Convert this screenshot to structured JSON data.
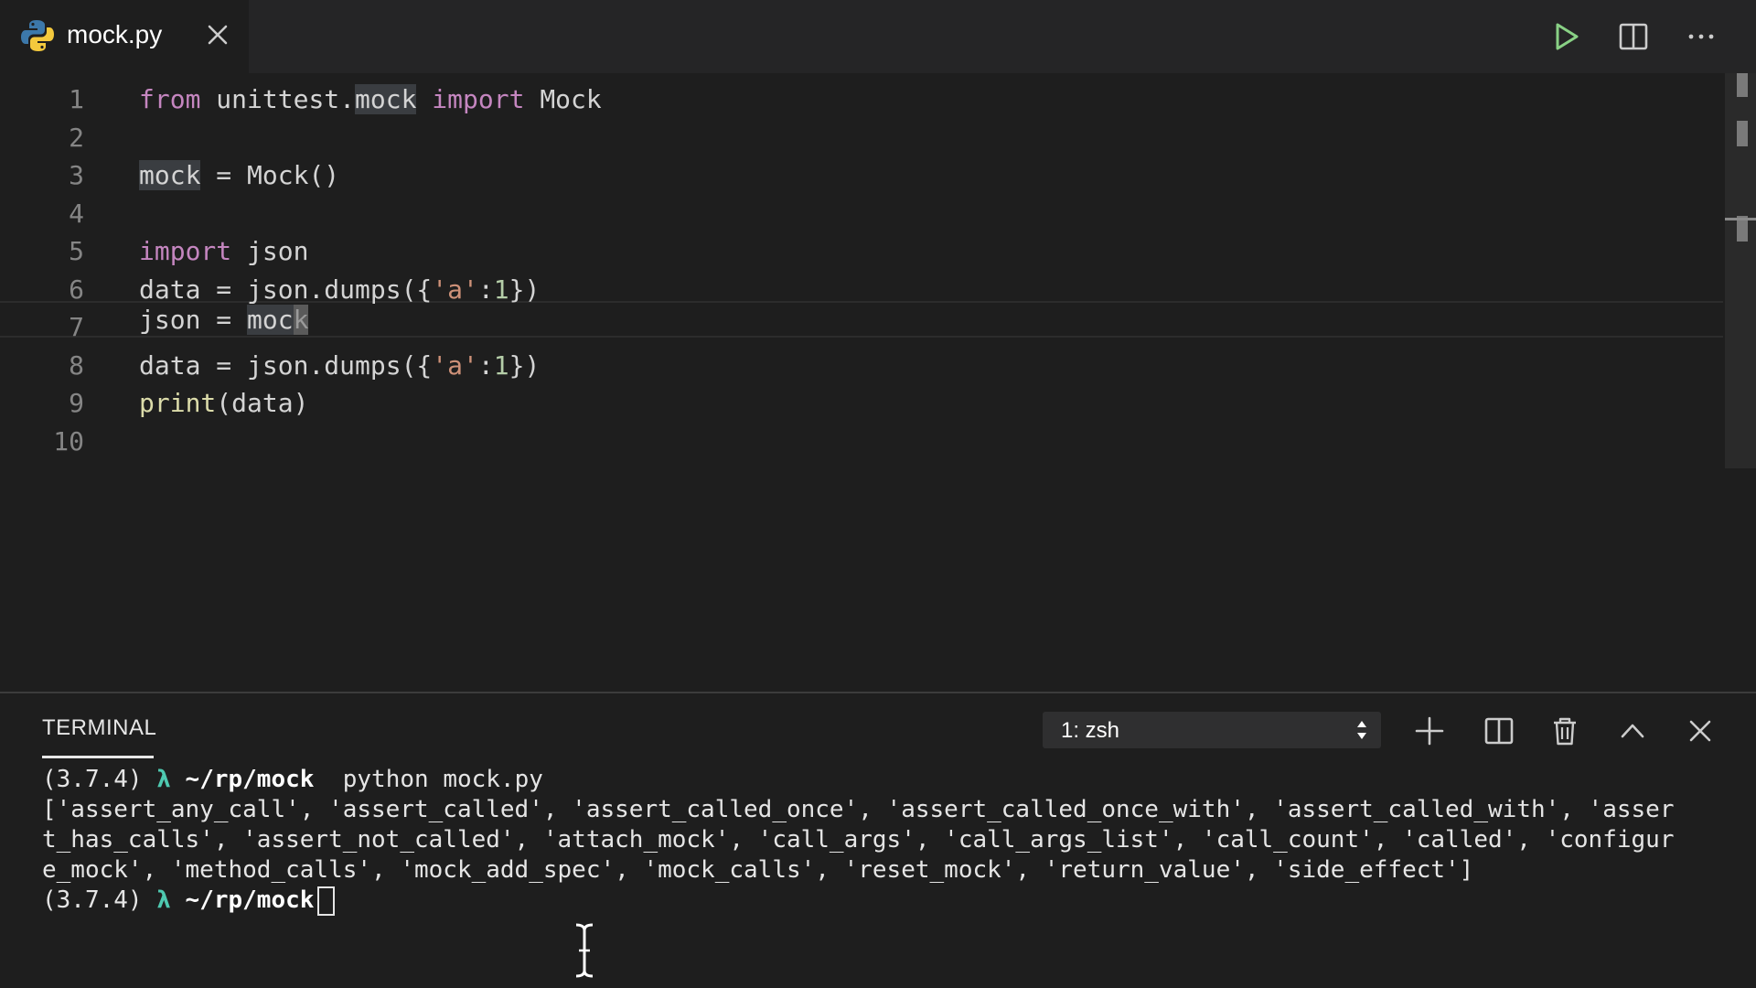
{
  "tab": {
    "filename": "mock.py"
  },
  "editor": {
    "line_numbers": [
      "1",
      "2",
      "3",
      "4",
      "5",
      "6",
      "7",
      "8",
      "9",
      "10"
    ],
    "code": {
      "l1": {
        "kw_from": "from",
        "module_a": " unittest.",
        "module_b": "mock",
        "kw_import": " import",
        "name": " Mock"
      },
      "l3": {
        "var": "mock",
        "rest": " = Mock()"
      },
      "l5": {
        "kw": "import",
        "rest": " json"
      },
      "l6": {
        "a": "data = json.dumps({",
        "str": "'a'",
        "b": ":",
        "num": "1",
        "c": "})"
      },
      "l7": {
        "a": "json = ",
        "hl": "moc",
        "caret": "k"
      },
      "l8": {
        "a": "data = json.dumps({",
        "str": "'a'",
        "b": ":",
        "num": "1",
        "c": "})"
      },
      "l9": {
        "fn": "print",
        "rest": "(data)"
      }
    }
  },
  "panel": {
    "title": "TERMINAL",
    "terminal_select": "1: zsh"
  },
  "terminal": {
    "line1": {
      "env": "(3.7.4) ",
      "lambda": "λ",
      "path": " ~/rp/mock",
      "cmd": "  python mock.py"
    },
    "output": [
      "['assert_any_call', 'assert_called', 'assert_called_once', 'assert_called_once_with', 'assert_called_with', 'asser",
      "t_has_calls', 'assert_not_called', 'attach_mock', 'call_args', 'call_args_list', 'call_count', 'called', 'configur",
      "e_mock', 'method_calls', 'mock_add_spec', 'mock_calls', 'reset_mock', 'return_value', 'side_effect']"
    ],
    "line_last": {
      "env": "(3.7.4) ",
      "lambda": "λ",
      "path": " ~/rp/mock"
    }
  },
  "icons": {
    "python": "python-logo-icon",
    "close": "close-icon",
    "run": "run-icon",
    "split": "split-editor-icon",
    "more": "more-actions-icon",
    "add": "plus-icon",
    "split_terminal": "split-terminal-icon",
    "trash": "trash-icon",
    "maximize": "chevron-up-icon",
    "close_panel": "close-icon"
  },
  "colors": {
    "keyword": "#c586c0",
    "function": "#dcdcaa",
    "string": "#ce9178",
    "number": "#b5cea8",
    "lambda": "#4ec9b0",
    "run": "#89d185"
  }
}
